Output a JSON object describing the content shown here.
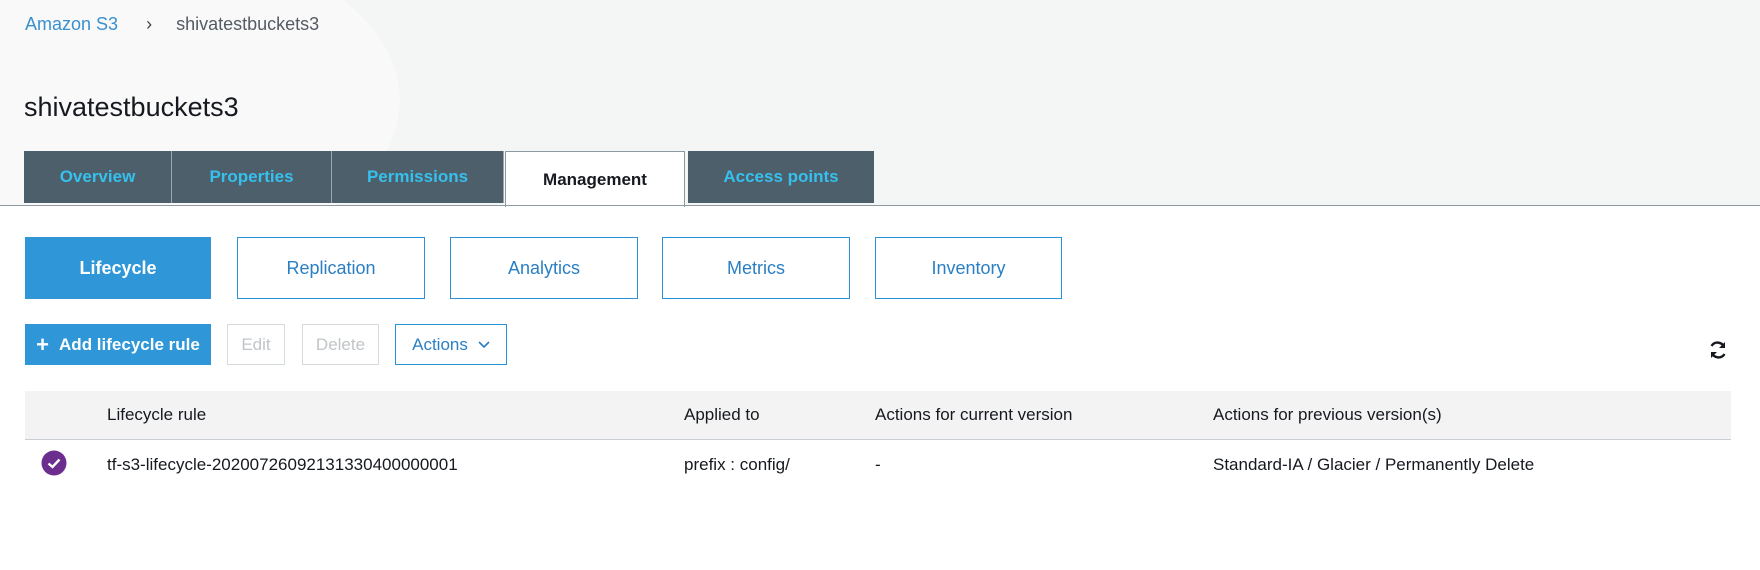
{
  "breadcrumb": {
    "root": "Amazon S3",
    "separator": "›",
    "current": "shivatestbuckets3"
  },
  "page": {
    "title": "shivatestbuckets3"
  },
  "tabs": [
    {
      "label": "Overview",
      "active": false
    },
    {
      "label": "Properties",
      "active": false
    },
    {
      "label": "Permissions",
      "active": false
    },
    {
      "label": "Management",
      "active": true
    },
    {
      "label": "Access points",
      "active": false
    }
  ],
  "subtabs": [
    {
      "label": "Lifecycle",
      "active": true
    },
    {
      "label": "Replication",
      "active": false
    },
    {
      "label": "Analytics",
      "active": false
    },
    {
      "label": "Metrics",
      "active": false
    },
    {
      "label": "Inventory",
      "active": false
    }
  ],
  "toolbar": {
    "add_label": "Add lifecycle rule",
    "edit_label": "Edit",
    "delete_label": "Delete",
    "actions_label": "Actions"
  },
  "table": {
    "headers": [
      "Lifecycle rule",
      "Applied to",
      "Actions for current version",
      "Actions for previous version(s)"
    ],
    "rows": [
      {
        "selected": true,
        "cells": [
          "tf-s3-lifecycle-20200726092131330400000001",
          "prefix : config/",
          "-",
          "Standard-IA / Glacier / Permanently Delete"
        ]
      }
    ]
  },
  "colors": {
    "accent": "#2f97d8",
    "tab_bg": "#4d5f6b",
    "tab_text": "#36c0ee",
    "check": "#6b2e8f"
  },
  "icons": [
    "chevron-right-icon",
    "plus-icon",
    "chevron-down-icon",
    "refresh-icon",
    "check-circle-icon"
  ]
}
